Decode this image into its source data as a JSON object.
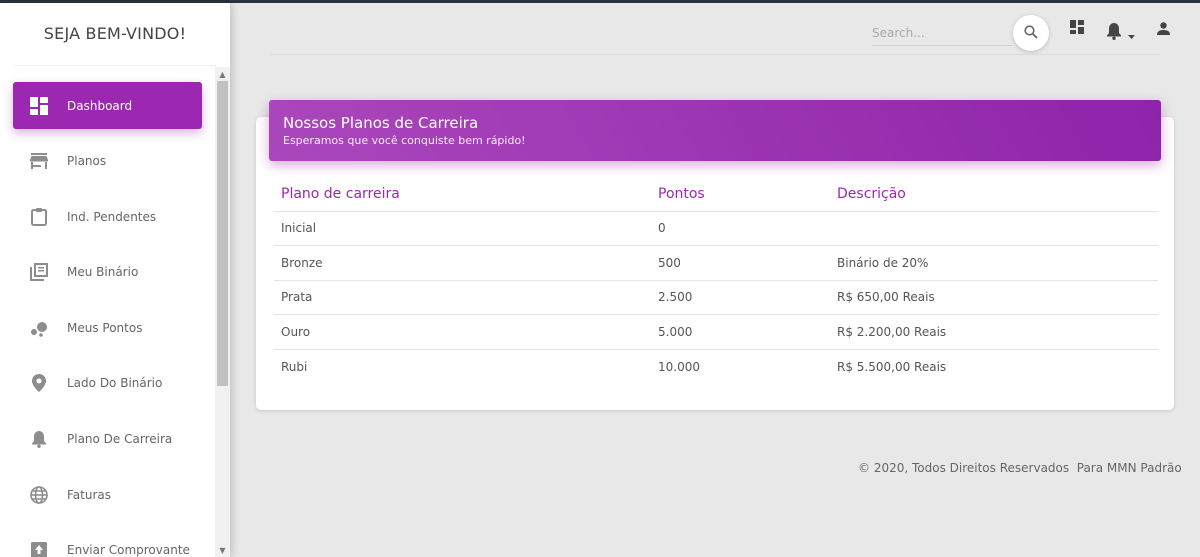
{
  "sidebar": {
    "brand": "SEJA BEM-VINDO!",
    "items": [
      {
        "label": "Dashboard",
        "icon": "dashboard-icon",
        "active": true
      },
      {
        "label": "Planos",
        "icon": "store-icon",
        "active": false
      },
      {
        "label": "Ind. Pendentes",
        "icon": "clipboard-icon",
        "active": false
      },
      {
        "label": "Meu Binário",
        "icon": "library-icon",
        "active": false
      },
      {
        "label": "Meus Pontos",
        "icon": "bubbles-icon",
        "active": false
      },
      {
        "label": "Lado Do Binário",
        "icon": "location-pin-icon",
        "active": false
      },
      {
        "label": "Plano De Carreira",
        "icon": "bell-icon",
        "active": false
      },
      {
        "label": "Faturas",
        "icon": "globe-icon",
        "active": false
      },
      {
        "label": "Enviar Comprovante",
        "icon": "upload-icon",
        "active": false
      }
    ]
  },
  "topbar": {
    "search_placeholder": "Search...",
    "search_value": ""
  },
  "card": {
    "title": "Nossos Planos de Carreira",
    "subtitle": "Esperamos que você conquiste bem rápido!",
    "columns": [
      "Plano de carreira",
      "Pontos",
      "Descrição"
    ],
    "rows": [
      [
        "Inicial",
        "0",
        ""
      ],
      [
        "Bronze",
        "500",
        "Binário de 20%"
      ],
      [
        "Prata",
        "2.500",
        "R$ 650,00 Reais"
      ],
      [
        "Ouro",
        "5.000",
        "R$ 2.200,00 Reais"
      ],
      [
        "Rubi",
        "10.000",
        "R$ 5.500,00 Reais"
      ]
    ]
  },
  "footer": {
    "text": "© 2020, Todos Direitos Reservados  Para MMN Padrão"
  },
  "colors": {
    "accent": "#9c27b0",
    "background": "#e8e8e8"
  }
}
